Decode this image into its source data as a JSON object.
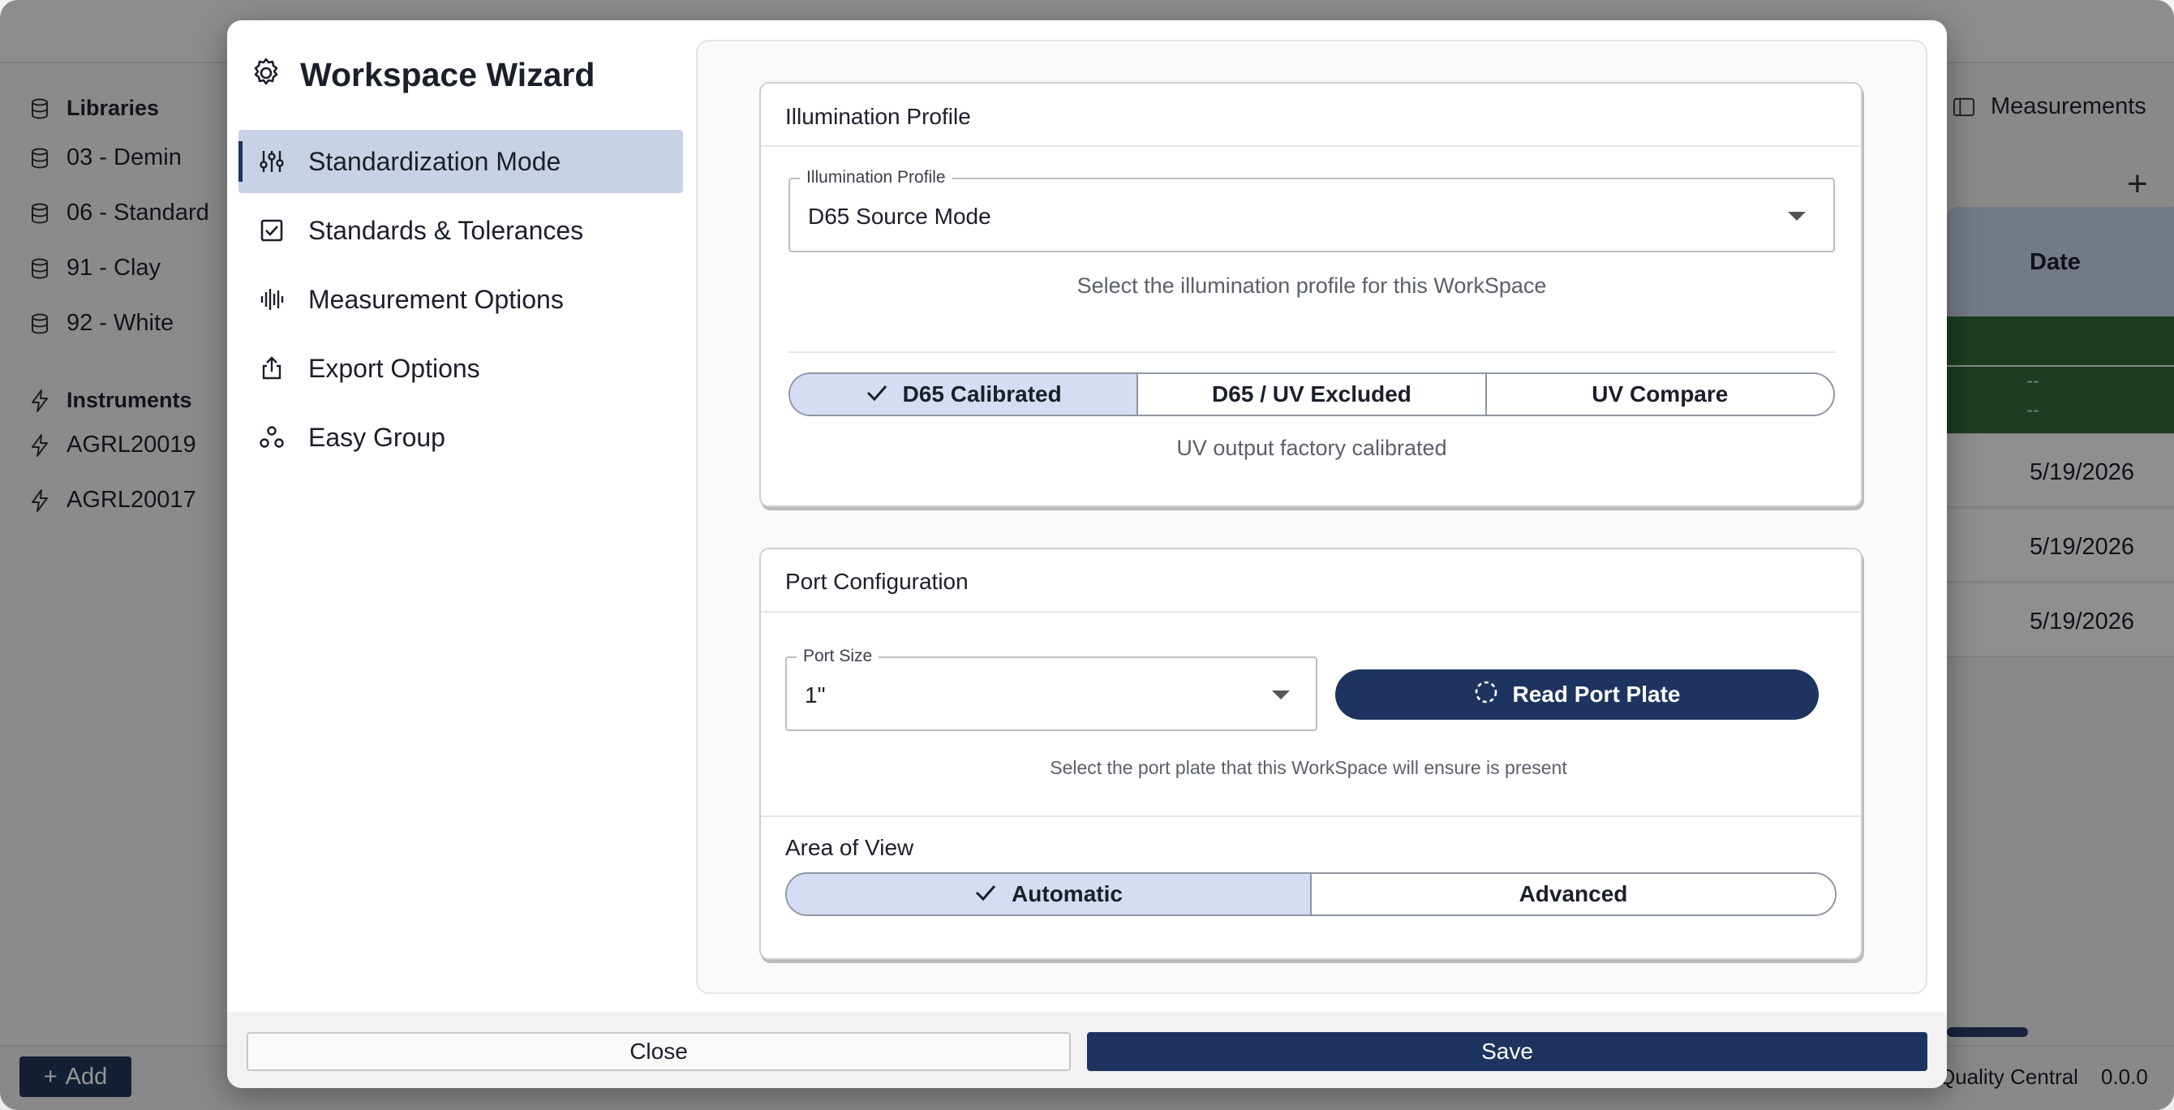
{
  "background": {
    "libraries_title": "Libraries",
    "libraries": [
      "03 - Demin",
      "06 - Standard",
      "91 - Clay",
      "92 - White"
    ],
    "instruments_title": "Instruments",
    "instruments": [
      "AGRL20019",
      "AGRL20017"
    ],
    "add_label": "Add",
    "measurements_label": "Measurements",
    "date_header": "Date",
    "row_placeholders": [
      "--",
      "--"
    ],
    "dates": [
      "5/19/2026",
      "5/19/2026",
      "5/19/2026"
    ],
    "footer_app": "Quality Central",
    "footer_version": "0.0.0"
  },
  "wizard": {
    "title": "Workspace Wizard",
    "nav": [
      {
        "label": "Standardization Mode",
        "icon": "sliders-icon",
        "active": true
      },
      {
        "label": "Standards & Tolerances",
        "icon": "checkbox-icon",
        "active": false
      },
      {
        "label": "Measurement Options",
        "icon": "waveform-icon",
        "active": false
      },
      {
        "label": "Export Options",
        "icon": "share-icon",
        "active": false
      },
      {
        "label": "Easy Group",
        "icon": "group-icon",
        "active": false
      }
    ],
    "illumination": {
      "card_title": "Illumination Profile",
      "field_label": "Illumination Profile",
      "field_value": "D65 Source Mode",
      "helper": "Select the illumination profile for this WorkSpace",
      "options": [
        "D65 Calibrated",
        "D65 / UV Excluded",
        "UV Compare"
      ],
      "selected": "D65 Calibrated",
      "status": "UV output factory calibrated"
    },
    "port": {
      "card_title": "Port Configuration",
      "field_label": "Port Size",
      "field_value": "1\"",
      "read_button": "Read Port Plate",
      "helper": "Select the port plate that this WorkSpace will ensure is present",
      "aov_title": "Area of View",
      "aov_options": [
        "Automatic",
        "Advanced"
      ],
      "aov_selected": "Automatic"
    },
    "footer": {
      "close_label": "Close",
      "save_label": "Save"
    }
  },
  "colors": {
    "accent": "#1e3460",
    "selected_segment": "#d5dcf3",
    "nav_active": "#c9d1e6"
  }
}
